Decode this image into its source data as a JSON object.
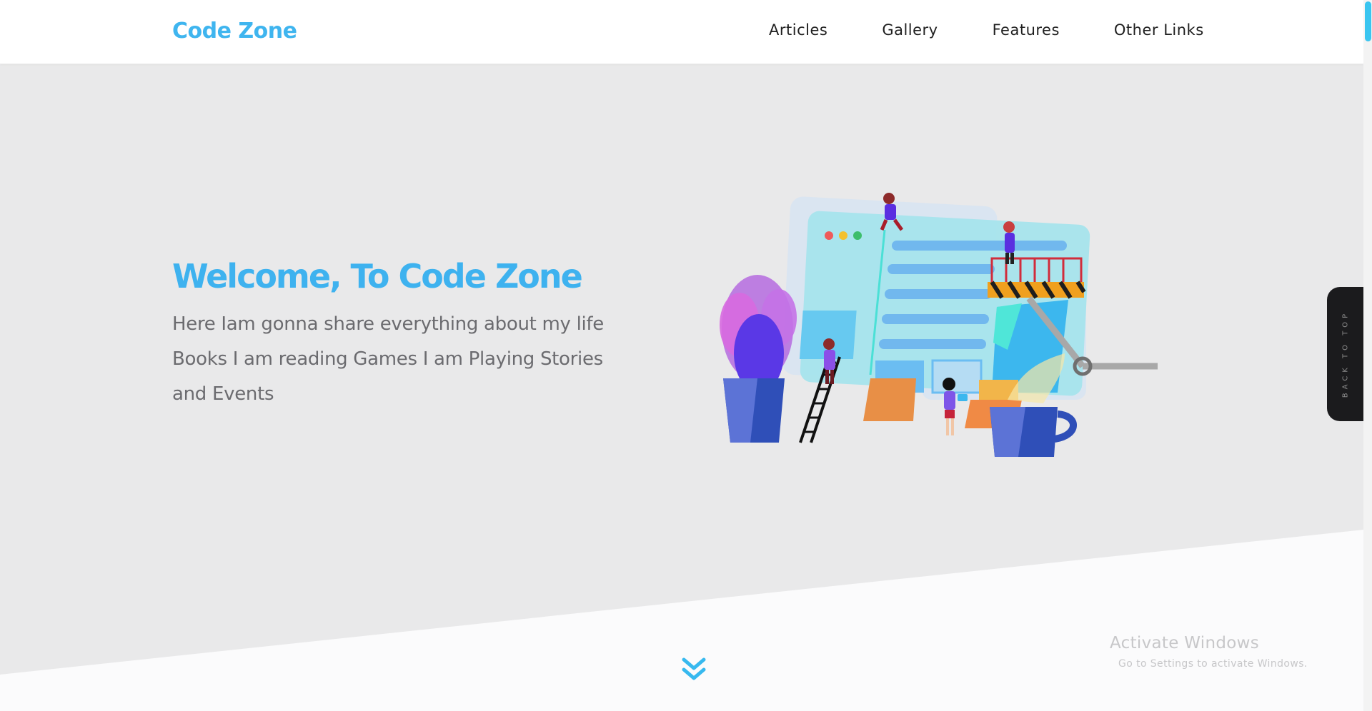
{
  "header": {
    "logo": "Code Zone",
    "nav": [
      {
        "label": "Articles"
      },
      {
        "label": "Gallery"
      },
      {
        "label": "Features"
      },
      {
        "label": "Other Links"
      }
    ]
  },
  "hero": {
    "title": "Welcome, To Code Zone",
    "text": "Here Iam gonna share everything about my life Books I am reading Games I am Playing Stories and Events"
  },
  "side_tab": {
    "label": "BACK TO TOP"
  },
  "watermark": {
    "line1": "Activate Windows",
    "line2": "Go to Settings to activate Windows."
  },
  "colors": {
    "accent": "#3eb2ef",
    "hero_bg": "#e9e9ea",
    "header_bg": "#ffffff",
    "side_tab": "#1b1b1d"
  },
  "icons": {
    "scroll_down": "double-chevron-down-icon"
  }
}
